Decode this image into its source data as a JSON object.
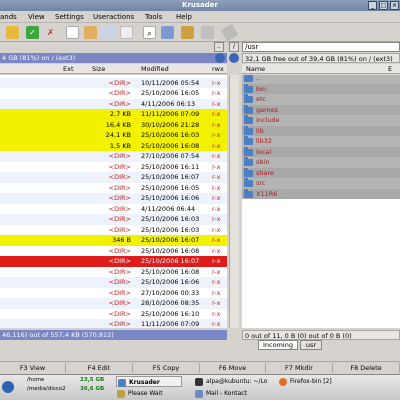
{
  "window": {
    "title": "Krusader"
  },
  "menu": [
    "ands",
    "View",
    "Settings",
    "Useractions",
    "Tools",
    "Help"
  ],
  "left_panel": {
    "info": "4 GB (81%) on / (ext3)",
    "columns": [
      "Ext",
      "Size",
      "Modified",
      "rwx"
    ],
    "rows": [
      {
        "size": "<DIR>",
        "modified": "25/10/2006 16:08",
        "rwx": "r-x",
        "bg": "#ffffff"
      },
      {
        "size": "<DIR>",
        "modified": "10/11/2006 05:54",
        "rwx": "r-x",
        "bg": "#eef2fa"
      },
      {
        "size": "<DIR>",
        "modified": "25/10/2006 16:05",
        "rwx": "r-x",
        "bg": "#ffffff"
      },
      {
        "size": "<DIR>",
        "modified": "4/11/2006 06:13",
        "rwx": "r-x",
        "bg": "#eef2fa"
      },
      {
        "size": "2,7 KB",
        "modified": "11/11/2006 07:09",
        "rwx": "r-x",
        "bg": "#f2f200"
      },
      {
        "size": "16,4 KB",
        "modified": "30/10/2006 21:28",
        "rwx": "r-x",
        "bg": "#f2f200"
      },
      {
        "size": "24,1 KB",
        "modified": "25/10/2006 16:03",
        "rwx": "r-x",
        "bg": "#f2f200"
      },
      {
        "size": "1,5 KB",
        "modified": "25/10/2006 16:08",
        "rwx": "r-x",
        "bg": "#f2f200"
      },
      {
        "size": "<DIR>",
        "modified": "27/10/2006 07:54",
        "rwx": "r-x",
        "bg": "#eef2fa"
      },
      {
        "size": "<DIR>",
        "modified": "25/10/2006 16:11",
        "rwx": "r-x",
        "bg": "#ffffff"
      },
      {
        "size": "<DIR>",
        "modified": "25/10/2006 16:07",
        "rwx": "r-x",
        "bg": "#eef2fa"
      },
      {
        "size": "<DIR>",
        "modified": "25/10/2006 16:05",
        "rwx": "r-x",
        "bg": "#ffffff"
      },
      {
        "size": "<DIR>",
        "modified": "25/10/2006 16:06",
        "rwx": "r-x",
        "bg": "#eef2fa"
      },
      {
        "size": "<DIR>",
        "modified": "4/11/2006 06:44",
        "rwx": "r-x",
        "bg": "#ffffff"
      },
      {
        "size": "<DIR>",
        "modified": "25/10/2006 16:03",
        "rwx": "r-x",
        "bg": "#eef2fa"
      },
      {
        "size": "<DIR>",
        "modified": "25/10/2006 16:03",
        "rwx": "r-x",
        "bg": "#ffffff"
      },
      {
        "size": "346 B",
        "modified": "25/10/2006 16:07",
        "rwx": "r-x",
        "bg": "#f2f200"
      },
      {
        "size": "<DIR>",
        "modified": "25/10/2006 16:08",
        "rwx": "r-x",
        "bg": "#ffffff"
      },
      {
        "size": "<DIR>",
        "modified": "25/10/2006 16:07",
        "rwx": "r-x",
        "bg": "#dd1c1c"
      },
      {
        "size": "<DIR>",
        "modified": "25/10/2006 16:08",
        "rwx": "r-x",
        "bg": "#ffffff"
      },
      {
        "size": "<DIR>",
        "modified": "25/10/2006 16:06",
        "rwx": "r-x",
        "bg": "#eef2fa"
      },
      {
        "size": "<DIR>",
        "modified": "27/10/2006 00:33",
        "rwx": "r-x",
        "bg": "#ffffff"
      },
      {
        "size": "<DIR>",
        "modified": "28/10/2006 08:35",
        "rwx": "r-x",
        "bg": "#eef2fa"
      },
      {
        "size": "<DIR>",
        "modified": "25/10/2006 16:10",
        "rwx": "r-x",
        "bg": "#ffffff"
      },
      {
        "size": "<DIR>",
        "modified": "11/11/2006 07:09",
        "rwx": "r-x",
        "bg": "#eef2fa"
      },
      {
        "size": "<DIR>",
        "modified": "25/10/2006 16:11",
        "rwx": "r-x",
        "bg": "#ffffff"
      }
    ],
    "status": "46,116) out of 557,4 KB (570,812)"
  },
  "right_panel": {
    "path": "/usr",
    "info": "32,1 GB free out of 39,4 GB (81%) on / (ext3)",
    "columns": [
      "Name",
      "E"
    ],
    "items": [
      "..",
      "bin",
      "etc",
      "games",
      "include",
      "lib",
      "lib32",
      "local",
      "sbin",
      "share",
      "src",
      "X11R6"
    ],
    "status": "0 out of 11, 0 B (0) out of 0 B (0)",
    "tabs": [
      "Incoming",
      "usr"
    ]
  },
  "fkeys": [
    "F3 View",
    "F4 Edit",
    "F5 Copy",
    "F6 Move",
    "F7 Mkdir",
    "F8 Delete"
  ],
  "taskbar": {
    "mount_home": "/home",
    "mount_media": "/media/disco2",
    "free_home": "23,5 GB",
    "free_media": "36,6 GB",
    "tasks": [
      "Krusader",
      "alpa@kubuntu: ~/Lo",
      "Firefox-bin [2]",
      "Please Wait",
      "Mail - Kontact"
    ]
  },
  "colors": {
    "selected_row": "#dd1c1c",
    "highlight_row": "#f2f200",
    "alt_row": "#eef2fa",
    "dir_text": "#c02020",
    "info_bar": "#7a86c6"
  }
}
